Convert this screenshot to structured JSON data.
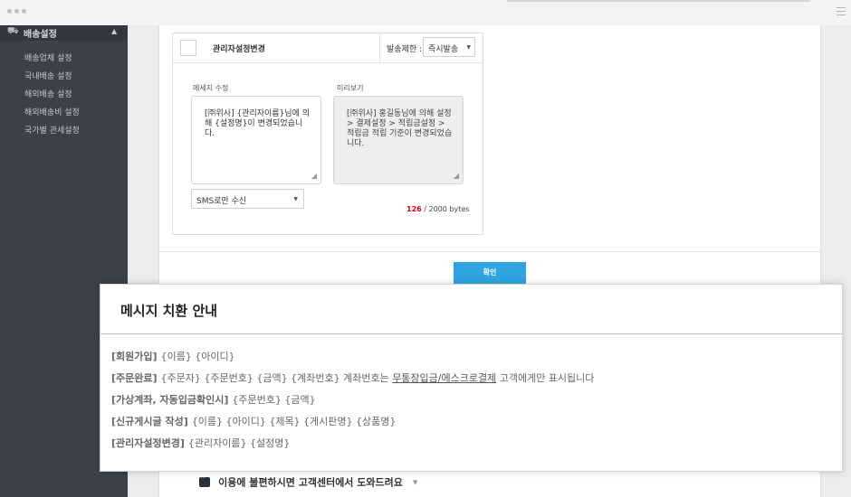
{
  "sidebar": {
    "title": "배송설정",
    "items": [
      {
        "label": "배송업체 설정"
      },
      {
        "label": "국내배송 설정"
      },
      {
        "label": "해외배송 설정"
      },
      {
        "label": "해외배송비 설정"
      },
      {
        "label": "국가별 관세설정"
      }
    ]
  },
  "card": {
    "title": "관리자설정변경",
    "send_limit_label": "발송제한 :",
    "send_limit_value": "즉시발송",
    "edit_label": "메세지 수정",
    "preview_label": "미리보기",
    "edit_text": "[㈜위사] {관리자이름}님에 의해 {설정명}이 변경되었습니다.",
    "preview_text": "[㈜위사] 홍길동님에 의해 설정 > 결제설정 > 적립금설정 > 적립금 적립 기준이 변경되었습니다.",
    "sms_option": "SMS로만 수신",
    "bytes_used": "126",
    "bytes_total": " / 2000 bytes"
  },
  "confirm_label": "확인",
  "help_text": "이용에 불편하시면 고객센터에서 도와드려요",
  "overlay": {
    "title": "메시지 치환 안내",
    "rows": [
      {
        "category": "[회원가입]",
        "text": "{이름} {아이디}"
      },
      {
        "category": "[주문완료]",
        "text": "{주문자} {주문번호} {금액} {계좌번호} 계좌번호는 ",
        "link": "무통장입금/에스크로결제",
        "suffix": " 고객에게만 표시됩니다"
      },
      {
        "category": "[가상계좌, 자동입금확인시]",
        "text": "{주문번호} {금액}"
      },
      {
        "category": "[신규게시글 작성]",
        "text": "{이름} {아이디} {제목} {게시판명} {상품명}"
      },
      {
        "category": "[관리자설정변경]",
        "text": "{관리자이름} {설정명}"
      }
    ]
  },
  "colors": {
    "sidebar_bg": "#3c4049",
    "accent": "#2fa5e0",
    "byte_count": "#d0021b"
  }
}
